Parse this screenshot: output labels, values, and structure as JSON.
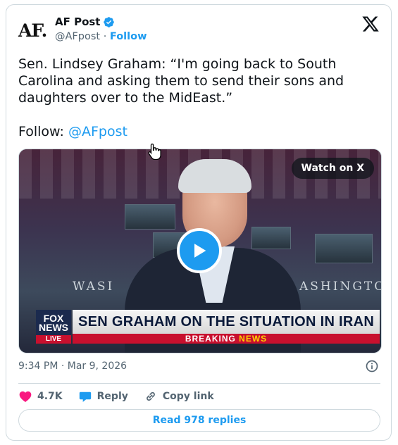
{
  "author": {
    "avatar_text": "AF.",
    "name": "AF Post",
    "handle": "@AFpost",
    "separator": "·",
    "follow_label": "Follow"
  },
  "tweet": {
    "text": "Sen. Lindsey Graham: “I'm going back to South Carolina and asking them to send their sons and daughters over to the MidEast.”",
    "follow_prefix": "Follow: ",
    "follow_mention": "@AFpost"
  },
  "video": {
    "watch_label": "Watch on X",
    "wall_left": "WASI",
    "wall_right": "ASHINGTO",
    "logo_line1": "FOX",
    "logo_line2": "NEWS",
    "logo_live": "LIVE",
    "headline": "SEN GRAHAM ON THE SITUATION IN IRAN",
    "breaking_word1": "BREAKING",
    "breaking_word2": "NEWS"
  },
  "meta": {
    "timestamp": "9:34 PM · Mar 9, 2026"
  },
  "actions": {
    "likes": "4.7K",
    "reply_label": "Reply",
    "copy_label": "Copy link",
    "read_replies": "Read 978 replies"
  },
  "colors": {
    "accent": "#1d9bf0",
    "like": "#f91880",
    "muted": "#536471"
  },
  "icons": [
    "verified-badge-icon",
    "x-logo-icon",
    "cursor-hand-icon",
    "play-icon",
    "info-icon",
    "heart-icon",
    "reply-bubble-icon",
    "link-icon"
  ]
}
